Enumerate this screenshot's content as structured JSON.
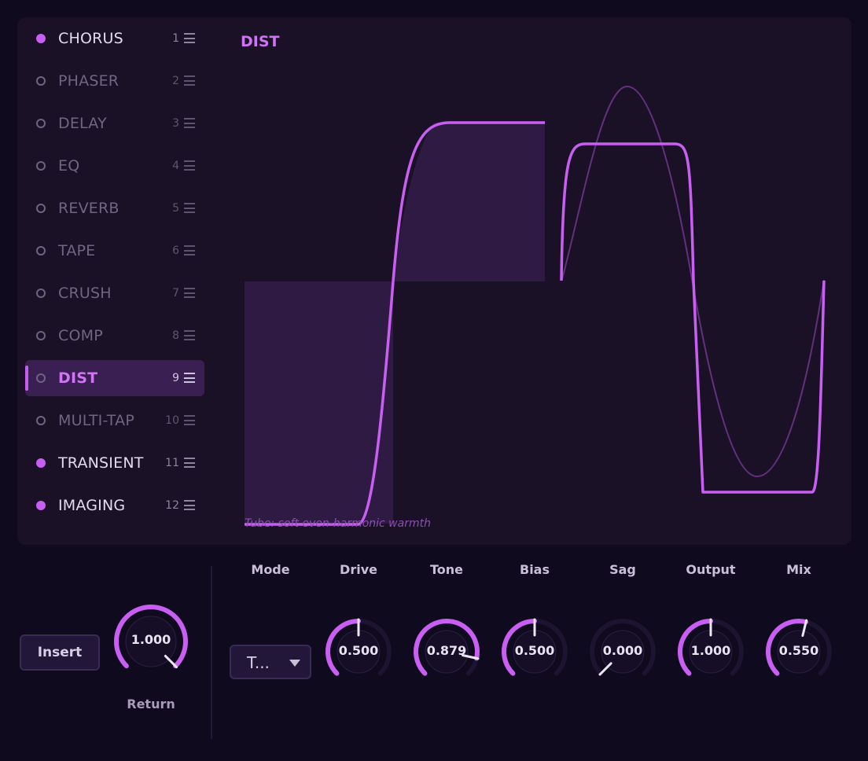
{
  "effects": [
    {
      "name": "CHORUS",
      "num": "1",
      "state": "on"
    },
    {
      "name": "PHASER",
      "num": "2",
      "state": "off"
    },
    {
      "name": "DELAY",
      "num": "3",
      "state": "off"
    },
    {
      "name": "EQ",
      "num": "4",
      "state": "off"
    },
    {
      "name": "REVERB",
      "num": "5",
      "state": "off"
    },
    {
      "name": "TAPE",
      "num": "6",
      "state": "off"
    },
    {
      "name": "CRUSH",
      "num": "7",
      "state": "off"
    },
    {
      "name": "COMP",
      "num": "8",
      "state": "off"
    },
    {
      "name": "DIST",
      "num": "9",
      "state": "selected"
    },
    {
      "name": "MULTI-TAP",
      "num": "10",
      "state": "off"
    },
    {
      "name": "TRANSIENT",
      "num": "11",
      "state": "on"
    },
    {
      "name": "IMAGING",
      "num": "12",
      "state": "on"
    }
  ],
  "panel": {
    "title": "DIST",
    "caption": "Tube: soft even-harmonic warmth"
  },
  "send": {
    "insert_label": "Insert",
    "return_label": "Return",
    "return_value": "1.000",
    "return_fraction": 1.0
  },
  "controls": {
    "mode": {
      "label": "Mode",
      "value": "T..."
    },
    "knobs": [
      {
        "id": "drive",
        "label": "Drive",
        "value": "0.500",
        "fraction": 0.5
      },
      {
        "id": "tone",
        "label": "Tone",
        "value": "0.879",
        "fraction": 0.879
      },
      {
        "id": "bias",
        "label": "Bias",
        "value": "0.500",
        "fraction": 0.5
      },
      {
        "id": "sag",
        "label": "Sag",
        "value": "0.000",
        "fraction": 0.0
      },
      {
        "id": "output",
        "label": "Output",
        "value": "1.000",
        "fraction": 0.5
      },
      {
        "id": "mix",
        "label": "Mix",
        "value": "0.550",
        "fraction": 0.55
      }
    ]
  },
  "colors": {
    "accent": "#c85ff2",
    "track": "#1c1430",
    "background": "#0f0a1d",
    "panel": "#1a1126"
  }
}
